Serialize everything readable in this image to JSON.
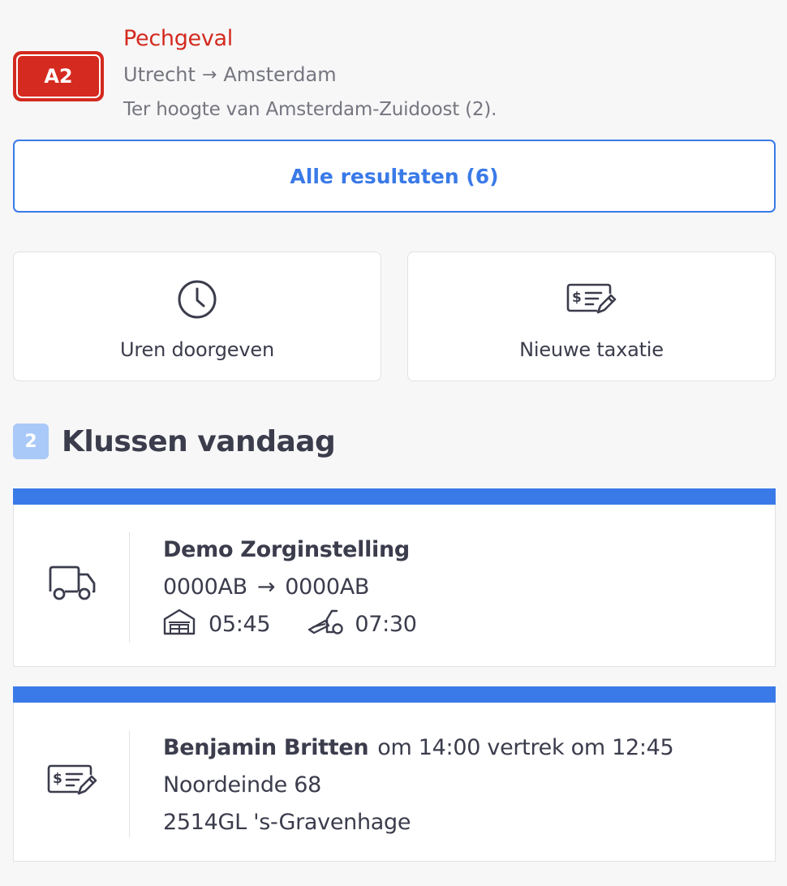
{
  "incident": {
    "road": "A2",
    "type": "Pechgeval",
    "from": "Utrecht",
    "arrow": "→",
    "to": "Amsterdam",
    "detail": "Ter hoogte van Amsterdam-Zuidoost (2)."
  },
  "results_button": {
    "label": "Alle resultaten (6)"
  },
  "actions": [
    {
      "label": "Uren doorgeven",
      "icon": "clock-icon"
    },
    {
      "label": "Nieuwe taxatie",
      "icon": "valuation-icon"
    }
  ],
  "jobs_section": {
    "count": "2",
    "title": "Klussen vandaag"
  },
  "jobs": [
    {
      "icon": "truck-icon",
      "title": "Demo Zorginstelling",
      "from_postcode": "0000AB",
      "arrow": "→",
      "to_postcode": "0000AB",
      "depot_time": "05:45",
      "tow_time": "07:30"
    },
    {
      "icon": "valuation-icon",
      "name": "Benjamin Britten",
      "schedule": "om 14:00 vertrek om 12:45",
      "street": "Noordeinde 68",
      "city": "2514GL 's-Gravenhage"
    }
  ],
  "colors": {
    "accent": "#3a7ae8",
    "alert": "#d42a1f",
    "badge": "#a9c9f8",
    "text": "#3b3c4c",
    "muted": "#75767f"
  }
}
